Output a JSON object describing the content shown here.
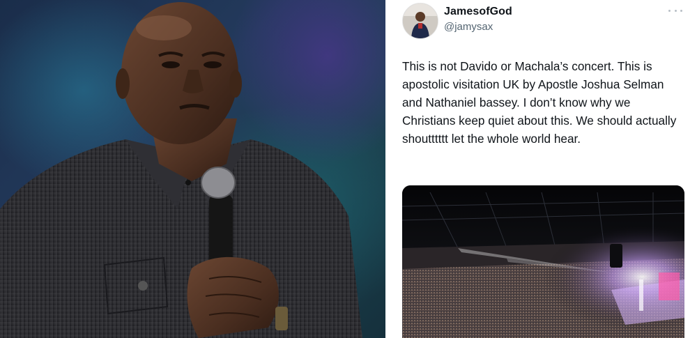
{
  "tweet": {
    "display_name": "JamesofGod",
    "handle": "@jamysax",
    "text": "This is not Davido or Machala’s concert. This is apostolic visitation UK by Apostle Joshua Selman and Nathaniel bassey. I don’t know why we Christians keep quiet about this. We should actually shoutttttt let the whole world hear."
  },
  "icons": {
    "more": "more-options-icon"
  },
  "colors": {
    "text_primary": "#0f1419",
    "text_secondary": "#536471",
    "background": "#ffffff"
  }
}
